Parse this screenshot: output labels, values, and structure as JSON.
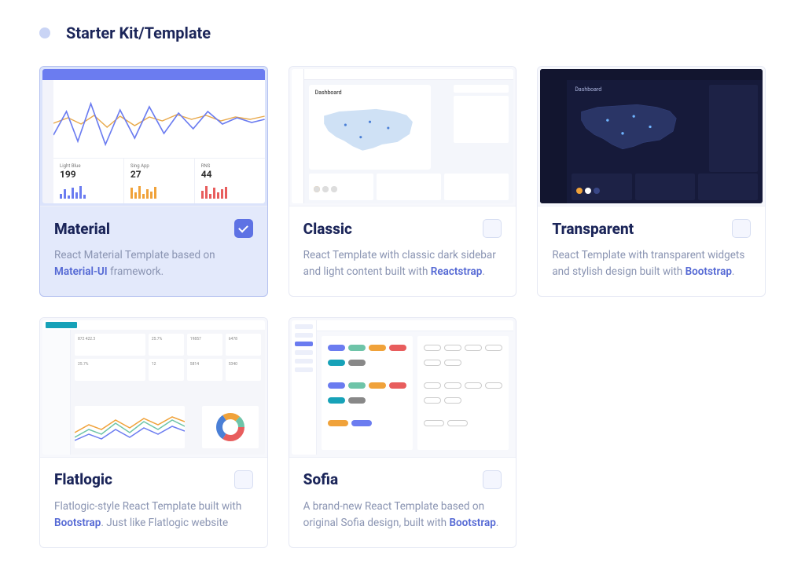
{
  "section": {
    "title": "Starter Kit/Template"
  },
  "cards": [
    {
      "title": "Material",
      "selected": true,
      "desc_parts": [
        "React Material Template based on ",
        "Material-UI",
        " framework."
      ]
    },
    {
      "title": "Classic",
      "selected": false,
      "desc_parts": [
        "React Template with classic dark sidebar and light content built with ",
        "Reactstrap",
        "."
      ]
    },
    {
      "title": "Transparent",
      "selected": false,
      "desc_parts": [
        "React Template with transparent widgets and stylish design built with ",
        "Bootstrap",
        "."
      ]
    },
    {
      "title": "Flatlogic",
      "selected": false,
      "desc_parts": [
        "Flatlogic-style React Template built with ",
        "Bootstrap",
        ". Just like Flatlogic website"
      ]
    },
    {
      "title": "Sofia",
      "selected": false,
      "desc_parts": [
        "A brand-new React Template based on original Sofia design, built with ",
        "Bootstrap",
        "."
      ]
    }
  ]
}
